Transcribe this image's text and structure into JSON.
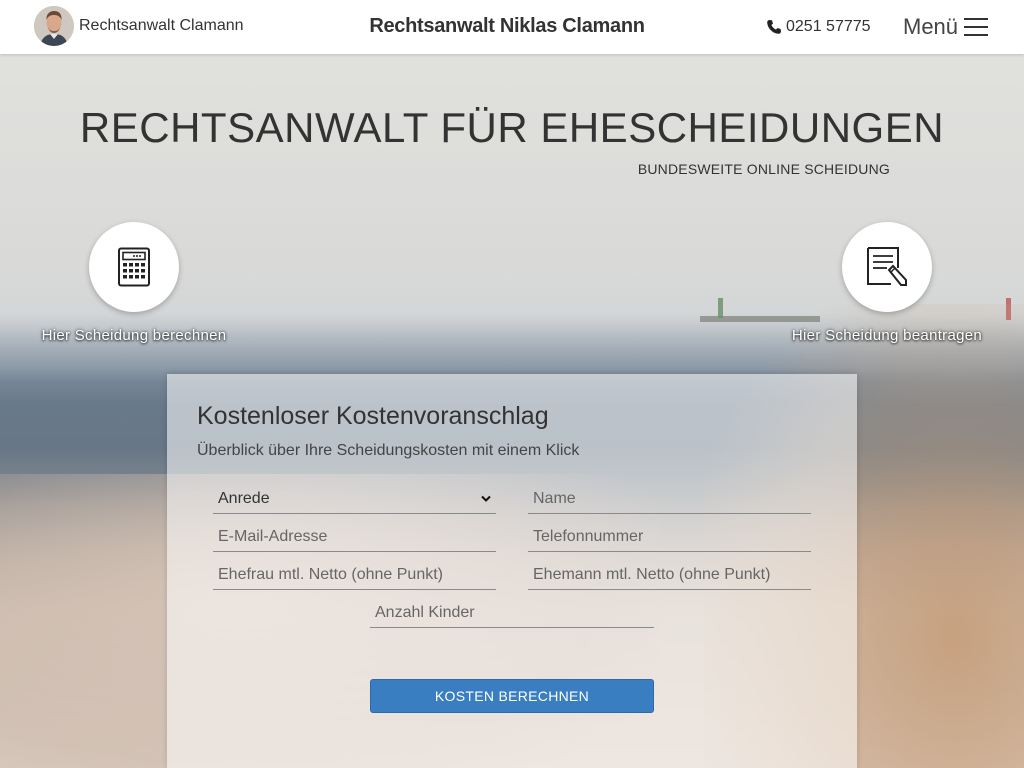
{
  "header": {
    "brand_label": "Rechtsanwalt Clamann",
    "site_title": "Rechtsanwalt Niklas Clamann",
    "phone": "0251 57775",
    "menu_label": "Menü"
  },
  "hero": {
    "title": "RECHTSANWALT FÜR EHESCHEIDUNGEN",
    "subtitle": "BUNDESWEITE ONLINE SCHEIDUNG",
    "left_link": {
      "label": "Hier Scheidung berechnen",
      "icon": "calculator-icon"
    },
    "right_link": {
      "label": "Hier Scheidung beantragen",
      "icon": "document-edit-icon"
    }
  },
  "form": {
    "title": "Kostenloser Kostenvoranschlag",
    "lead": "Überblick über Ihre Scheidungskosten mit einem Klick",
    "salutation_value": "Anrede",
    "name_placeholder": "Name",
    "email_placeholder": "E-Mail-Adresse",
    "phone_placeholder": "Telefonnummer",
    "wife_income_placeholder": "Ehefrau mtl. Netto (ohne Punkt)",
    "husband_income_placeholder": "Ehemann mtl. Netto (ohne Punkt)",
    "children_placeholder": "Anzahl Kinder",
    "submit_label": "KOSTEN BERECHNEN"
  },
  "colors": {
    "primary_button": "#3a7ec2",
    "header_bg": "#ffffff",
    "text": "#333333"
  }
}
